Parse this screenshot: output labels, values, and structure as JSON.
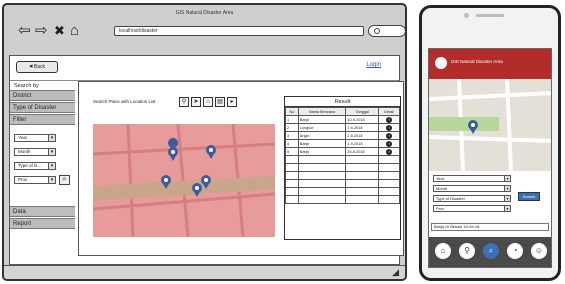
{
  "desktop": {
    "window_title": "GIS Natural Disaster Area",
    "url": "localhost/disaster",
    "back_label": "Back",
    "login_label": "Login",
    "sidebar": {
      "search_by": "Search by",
      "sections": [
        "District",
        "Type of Disaster"
      ],
      "filter_label": "Filter",
      "filter_selects": [
        "Year",
        "Month",
        "Type of D...",
        "Prov"
      ],
      "bottom_sections": [
        "Data",
        "Report"
      ]
    },
    "search_label": "Search Place with Location List",
    "result": {
      "title": "Result",
      "columns": [
        "No",
        "Nama Bencana",
        "Tanggal",
        "Detail"
      ],
      "rows": [
        [
          "1",
          "Banjir",
          "10-9-2018"
        ],
        [
          "2",
          "Longsor",
          "7-9-2018"
        ],
        [
          "3",
          "Angin",
          "2-9-2018"
        ],
        [
          "4",
          "Banjir",
          "1-9-2018"
        ],
        [
          "5",
          "Banjir",
          "25-8-2018"
        ]
      ]
    }
  },
  "mobile": {
    "header_title": "GIS Natural Disaster Area",
    "selects": [
      "Year",
      "Month",
      "Type of Disaster",
      "Prov"
    ],
    "search_button": "Search",
    "result_text": "Banjir Di Bekasi 10-09-18"
  }
}
